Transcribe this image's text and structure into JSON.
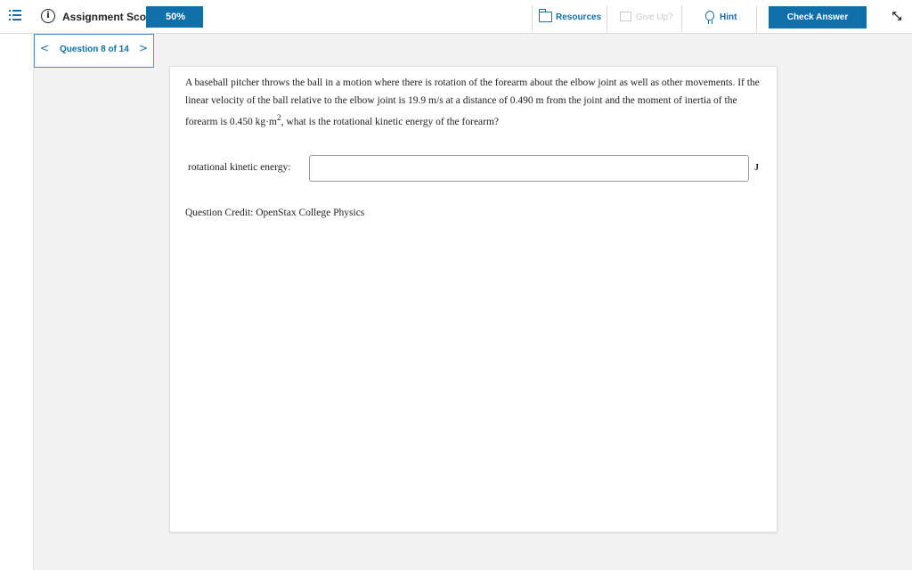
{
  "header": {
    "score_label": "Assignment Score:",
    "score_value": "50%",
    "resources_label": "Resources",
    "give_up_label": "Give Up?",
    "hint_label": "Hint",
    "check_answer_label": "Check Answer"
  },
  "navigator": {
    "label": "Question 8 of 14",
    "prev_glyph": "<",
    "next_glyph": ">"
  },
  "question": {
    "text_part1": "A baseball pitcher throws the ball in a motion where there is rotation of the forearm about the elbow joint as well as other movements. If the linear velocity of the ball relative to the elbow joint is 19.9 m/s at a distance of 0.490 m from the joint and the moment of inertia of the forearm is 0.450 kg·m",
    "text_sup": "2",
    "text_part2": ", what is the rotational kinetic energy of the forearm?",
    "answer_label": "rotational kinetic energy:",
    "answer_value": "",
    "unit": "J",
    "credit": "Question Credit: OpenStax College Physics"
  },
  "icons": {
    "menu": "menu-list-icon",
    "info": "info-icon",
    "resources": "folder-icon",
    "give_up": "flag-icon",
    "hint": "lightbulb-icon",
    "collapse": "collapse-icon"
  },
  "colors": {
    "accent": "#0f6fa8",
    "disabled": "#c9c9c9",
    "nav_border": "#4f8fc7"
  }
}
